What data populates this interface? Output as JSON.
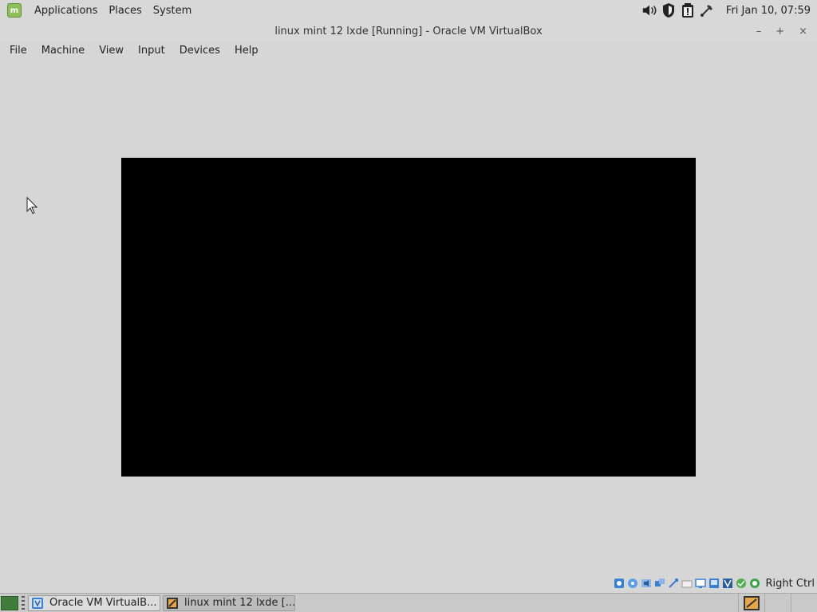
{
  "top_panel": {
    "menus": [
      "Applications",
      "Places",
      "System"
    ],
    "clock": "Fri Jan 10, 07:59",
    "tray_icons": [
      "volume-icon",
      "shield-icon",
      "clipboard-alert-icon",
      "network-icon"
    ]
  },
  "window": {
    "title": "linux mint 12 lxde [Running] - Oracle VM VirtualBox",
    "controls": {
      "minimize": "–",
      "maximize": "+",
      "close": "×"
    }
  },
  "menubar": {
    "items": [
      "File",
      "Machine",
      "View",
      "Input",
      "Devices",
      "Help"
    ]
  },
  "status_bar": {
    "icons": [
      "hard-disk-icon",
      "optical-drive-icon",
      "audio-icon",
      "network-icon",
      "usb-icon",
      "shared-folders-icon",
      "display-icon",
      "video-capture-icon",
      "recording-icon",
      "virtualization-icon",
      "mouse-integration-icon",
      "keyboard-capture-icon"
    ],
    "host_key": "Right Ctrl"
  },
  "taskbar": {
    "tasks": [
      {
        "label": "Oracle VM VirtualB...",
        "icon": "virtualbox-icon"
      },
      {
        "label": "linux mint 12 lxde [...",
        "icon": "vm-window-icon"
      }
    ]
  },
  "colors": {
    "panel": "#d8d8d8",
    "background": "#d6d6d6",
    "vm_screen": "#000000"
  }
}
